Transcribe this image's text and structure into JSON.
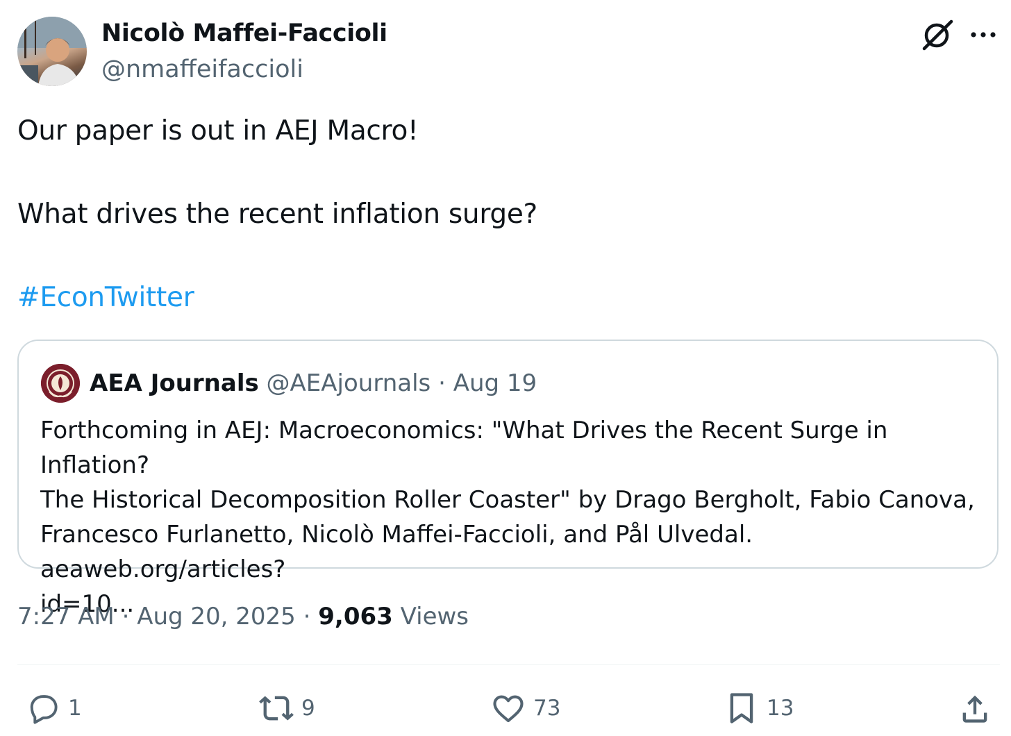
{
  "author": {
    "display_name": "Nicolò Maffei-Faccioli",
    "handle": "@nmaffeifaccioli"
  },
  "tweet": {
    "line1": "Our paper is out in AEJ Macro!",
    "line2": "What drives the recent inflation surge?",
    "hashtag": "#EconTwitter"
  },
  "quote": {
    "display_name": "AEA Journals",
    "handle": "@AEAjournals",
    "separator": "·",
    "date": "Aug 19",
    "text": "Forthcoming in AEJ: Macroeconomics: \"What Drives the Recent Surge in Inflation?\nThe Historical Decomposition Roller Coaster\" by Drago Bergholt, Fabio Canova,\nFrancesco Furlanetto, Nicolò Maffei-Faccioli, and Pål Ulvedal. aeaweb.org/articles?\nid=10..."
  },
  "meta": {
    "time": "7:27 AM",
    "separator": "·",
    "date": "Aug 20, 2025",
    "views_count": "9,063",
    "views_label": "Views"
  },
  "actions": {
    "replies": "1",
    "reposts": "9",
    "likes": "73",
    "bookmarks": "13"
  },
  "colors": {
    "text": "#0f1419",
    "secondary": "#536471",
    "link": "#1d9bf0",
    "border": "#cfd9de",
    "aea_badge": "#7b1e2b"
  },
  "icons": [
    "grok-icon",
    "more-icon",
    "reply-icon",
    "repost-icon",
    "like-icon",
    "bookmark-icon",
    "share-icon"
  ]
}
